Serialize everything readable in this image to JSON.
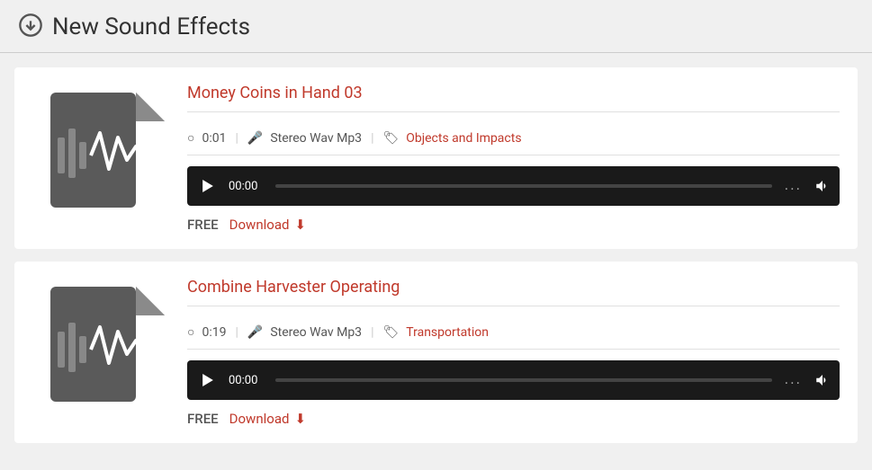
{
  "header": {
    "title": "New Sound Effects",
    "icon": "download-circle-icon"
  },
  "sounds": [
    {
      "id": "sound-1",
      "title": "Money Coins in Hand 03",
      "duration": "0:01",
      "format": "Stereo Wav Mp3",
      "category": "Objects and Impacts",
      "price": "FREE",
      "download_label": "Download",
      "time_display": "00:00"
    },
    {
      "id": "sound-2",
      "title": "Combine Harvester Operating",
      "duration": "0:19",
      "format": "Stereo Wav Mp3",
      "category": "Transportation",
      "price": "FREE",
      "download_label": "Download",
      "time_display": "00:00"
    }
  ]
}
